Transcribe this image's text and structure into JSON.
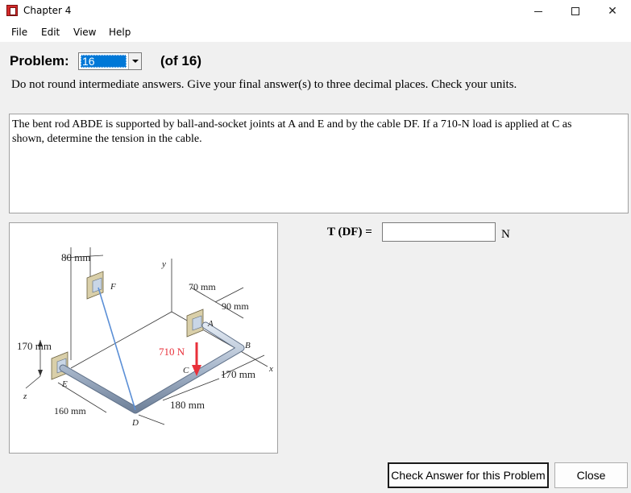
{
  "window": {
    "title": "Chapter 4",
    "controls": {
      "minimize": "—",
      "maximize": "☐",
      "close": "✕"
    }
  },
  "menu": {
    "items": [
      "File",
      "Edit",
      "View",
      "Help"
    ]
  },
  "problem": {
    "label": "Problem:",
    "selected": "16",
    "of_count": "(of 16)"
  },
  "instructions": "Do not round intermediate answers.  Give your final answer(s) to three decimal places.  Check your units.",
  "problem_text": {
    "line1": "The bent rod ABDE is supported by ball-and-socket joints at A and E and by the cable DF. If a 710-N load is applied at C as",
    "line2": "shown, determine the tension in the cable."
  },
  "figure": {
    "labels": {
      "dim_80": "80 mm",
      "dim_70": "70 mm",
      "dim_90": "90 mm",
      "dim_170_left": "170 mm",
      "dim_170_right": "170 mm",
      "dim_160": "160 mm",
      "dim_180": "180 mm",
      "load": "710 N",
      "pt_F": "F",
      "pt_A": "A",
      "pt_B": "B",
      "pt_C": "C",
      "pt_D": "D",
      "pt_E": "E",
      "axis_x": "x",
      "axis_y": "y",
      "axis_z": "z"
    },
    "colors": {
      "cable": "#5b8fd6",
      "load": "#e8303a",
      "rod": "#a9b8cc"
    }
  },
  "answer": {
    "label": "T (DF) =",
    "value": "",
    "unit": "N"
  },
  "buttons": {
    "check": "Check Answer for this Problem",
    "close": "Close"
  }
}
